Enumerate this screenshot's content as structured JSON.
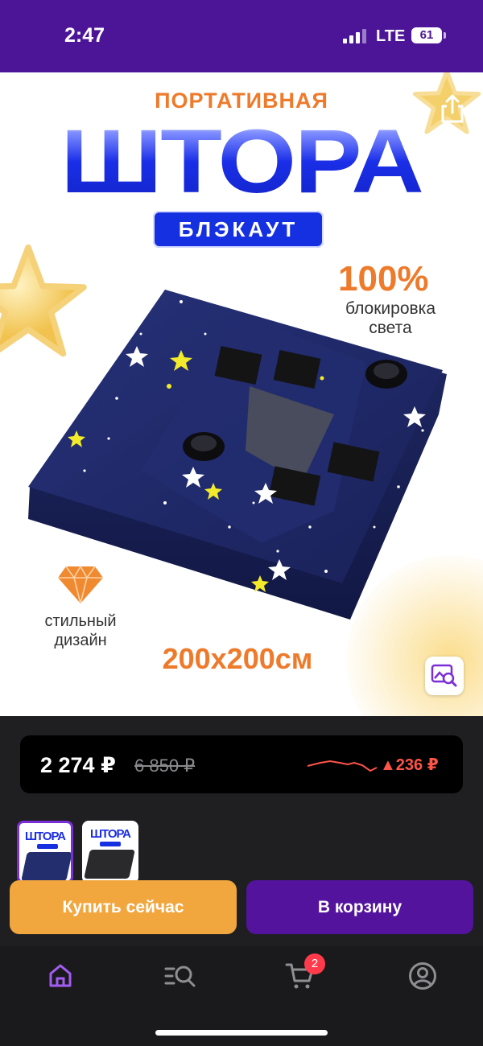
{
  "status_bar": {
    "time": "2:47",
    "network": "LTE",
    "battery": "61"
  },
  "hero": {
    "subtitle": "ПОРТАТИВНАЯ",
    "title": "ШТОРА",
    "badge": "БЛЭКАУТ",
    "percent": "100%",
    "percent_caption_1": "блокировка",
    "percent_caption_2": "света",
    "feature_1": "стильный",
    "feature_2": "дизайн",
    "size": "200x200см"
  },
  "price": {
    "current": "2 274 ₽",
    "old": "6 850 ₽",
    "change": "▲236 ₽"
  },
  "thumbnails": [
    {
      "title": "ШТОРА"
    },
    {
      "title": "ШТОРА"
    }
  ],
  "actions": {
    "buy_now": "Купить сейчас",
    "add_to_cart": "В корзину"
  },
  "tabbar": {
    "cart_count": "2"
  },
  "colors": {
    "accent_purple": "#4c1597",
    "buy_orange": "#f2a63e",
    "title_blue": "#1c2de0",
    "price_up_red": "#ff5448"
  },
  "icons": [
    "back-arrow-icon",
    "heart-icon",
    "share-icon",
    "image-search-icon",
    "home-icon",
    "catalog-search-icon",
    "cart-icon",
    "profile-icon"
  ]
}
